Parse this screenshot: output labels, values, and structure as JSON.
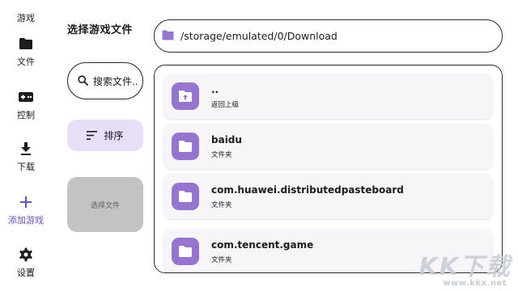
{
  "nav": {
    "items": [
      {
        "label": "游戏",
        "icon": "gamepad-icon"
      },
      {
        "label": "文件",
        "icon": "folder-icon"
      },
      {
        "label": "控制",
        "icon": "controller-icon"
      },
      {
        "label": "下载",
        "icon": "download-icon"
      },
      {
        "label": "添加游戏",
        "icon": "plus-icon"
      },
      {
        "label": "设置",
        "icon": "gear-icon"
      }
    ],
    "active_index": 4
  },
  "page": {
    "title": "选择游戏文件"
  },
  "path_bar": {
    "path": "/storage/emulated/0/Download",
    "icon": "folder-icon"
  },
  "search": {
    "label": "搜索文件..",
    "icon": "search-icon"
  },
  "sort": {
    "label": "排序",
    "icon": "sort-icon"
  },
  "select_file": {
    "label": "选择文件"
  },
  "files": [
    {
      "name": "..",
      "type": "返回上级",
      "icon": "folder-up-icon"
    },
    {
      "name": "baidu",
      "type": "文件夹",
      "icon": "folder-icon"
    },
    {
      "name": "com.huawei.distributedpasteboard",
      "type": "文件夹",
      "icon": "folder-icon"
    },
    {
      "name": "com.tencent.game",
      "type": "文件夹",
      "icon": "folder-icon"
    }
  ],
  "watermark": {
    "text": "KK下载",
    "url": "www.kkx.net"
  },
  "colors": {
    "accent": "#9575cd",
    "active_nav": "#6b4fbb",
    "sort_bg": "#e8def8",
    "disabled_bg": "#c4c4c4"
  }
}
